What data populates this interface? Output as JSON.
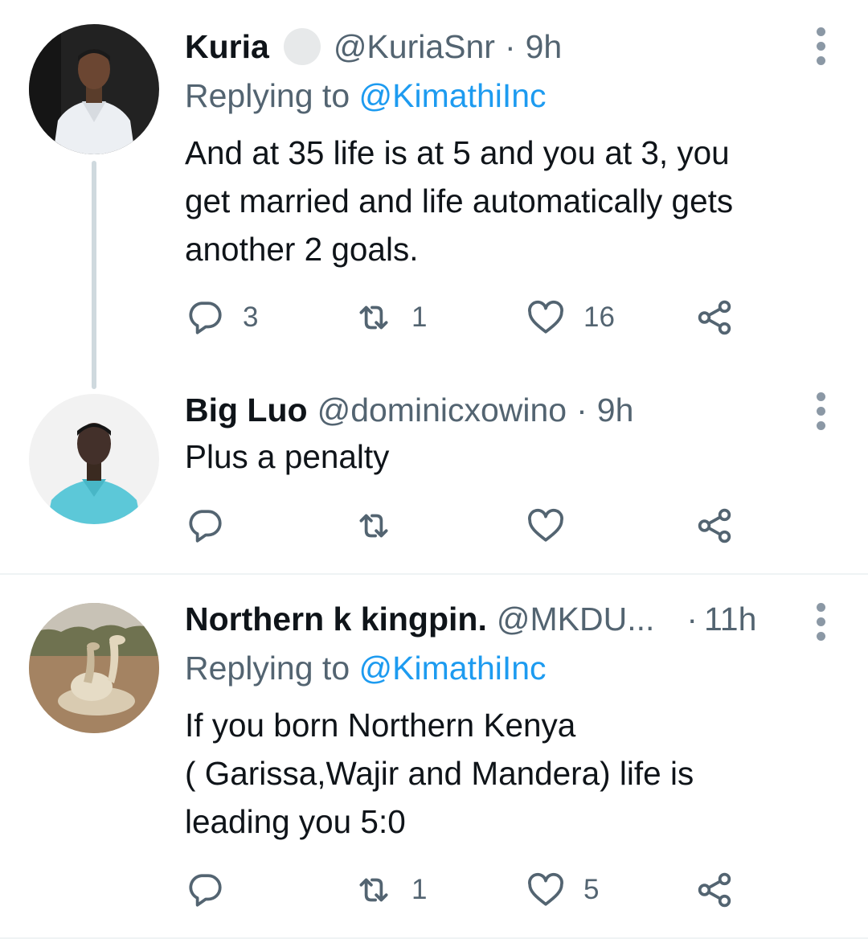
{
  "tweets": [
    {
      "name": "Kuria",
      "handle": "@KuriaSnr",
      "dot": "·",
      "time": "9h",
      "replying_prefix": "Replying to",
      "replying_to": "@KimathiInc",
      "text_lines": [
        "And at 35 life is at 5 and you at 3, you",
        "get married and life automatically gets",
        "another 2 goals."
      ],
      "replies": "3",
      "retweets": "1",
      "likes": "16"
    },
    {
      "name": "Big Luo",
      "handle": "@dominicxowino",
      "dot": "·",
      "time": "9h",
      "text_lines": [
        "Plus a penalty"
      ]
    },
    {
      "name": "Northern k kingpin.",
      "handle": "@MKDU...",
      "dot": "·",
      "time": "11h",
      "replying_prefix": "Replying to",
      "replying_to": "@KimathiInc",
      "text_lines": [
        "If you born Northern Kenya",
        "( Garissa,Wajir and Mandera) life is",
        "leading you 5:0"
      ],
      "retweets": "1",
      "likes": "5"
    }
  ],
  "colors": {
    "text": "#0f1419",
    "secondary": "#536471",
    "link": "#1d9bf0",
    "thread_line": "#cfd9de",
    "divider": "#eff3f4"
  },
  "icons": [
    "reply-icon",
    "retweet-icon",
    "like-icon",
    "share-icon",
    "more-icon",
    "verified-badge"
  ]
}
